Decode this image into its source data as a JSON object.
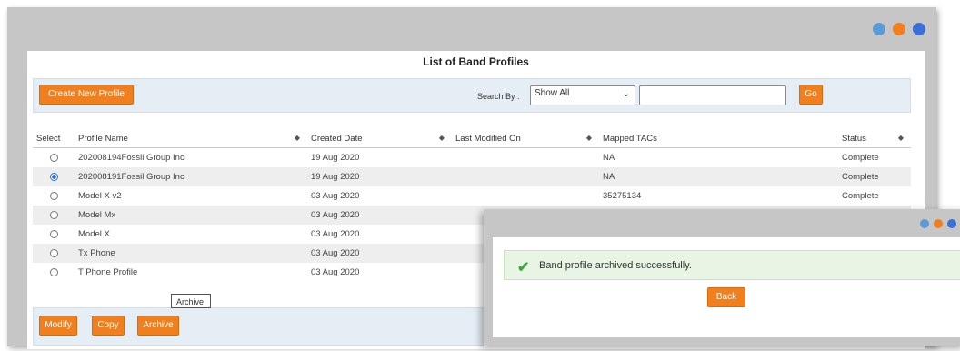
{
  "window": {
    "dots": [
      "#5b9bd5",
      "#f07f1f",
      "#3a6fd8"
    ]
  },
  "page": {
    "title": "List of Band Profiles"
  },
  "toolbar": {
    "create_label": "Create New Profile",
    "search_by_label": "Search By :",
    "search_select_value": "Show All",
    "search_input_value": "",
    "go_label": "Go"
  },
  "table": {
    "columns": [
      "Select",
      "Profile Name",
      "Created Date",
      "Last Modified On",
      "Mapped TACs",
      "Status"
    ],
    "rows": [
      {
        "selected": false,
        "profile_name": "202008194Fossil Group Inc",
        "created": "19 Aug 2020",
        "modified": "",
        "tacs": "NA",
        "status": "Complete"
      },
      {
        "selected": true,
        "profile_name": "202008191Fossil Group Inc",
        "created": "19 Aug 2020",
        "modified": "",
        "tacs": "NA",
        "status": "Complete"
      },
      {
        "selected": false,
        "profile_name": "Model X v2",
        "created": "03 Aug 2020",
        "modified": "",
        "tacs": "35275134",
        "status": "Complete"
      },
      {
        "selected": false,
        "profile_name": "Model Mx",
        "created": "03 Aug 2020",
        "modified": "",
        "tacs": "",
        "status": ""
      },
      {
        "selected": false,
        "profile_name": "Model X",
        "created": "03 Aug 2020",
        "modified": "",
        "tacs": "",
        "status": ""
      },
      {
        "selected": false,
        "profile_name": "Tx Phone",
        "created": "03 Aug 2020",
        "modified": "",
        "tacs": "",
        "status": ""
      },
      {
        "selected": false,
        "profile_name": "T Phone Profile",
        "created": "03 Aug 2020",
        "modified": "",
        "tacs": "",
        "status": ""
      }
    ]
  },
  "footer": {
    "modify_label": "Modify",
    "copy_label": "Copy",
    "archive_label": "Archive",
    "tooltip": "Archive"
  },
  "dialog": {
    "message": "Band profile archived successfully.",
    "back_label": "Back",
    "icon": "check-icon",
    "success_color": "#3ea53a"
  },
  "colors": {
    "accent": "#f07f1f"
  }
}
